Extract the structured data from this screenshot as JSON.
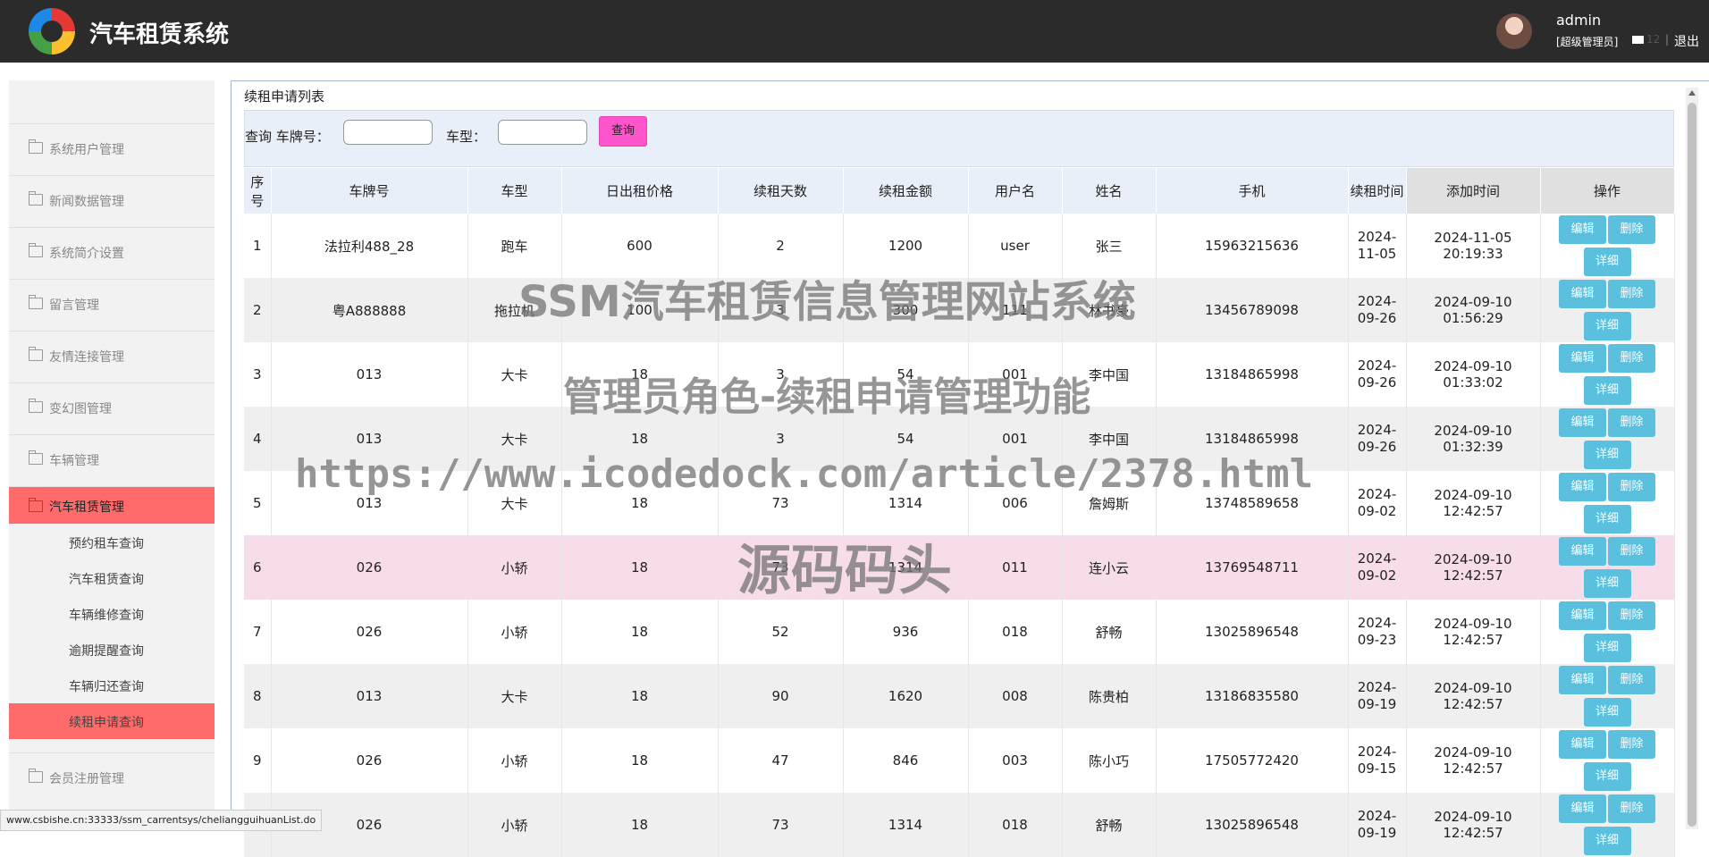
{
  "header": {
    "app_title": "汽车租赁系统",
    "user_name": "admin",
    "user_role": "[超级管理员]",
    "mail_count": "12",
    "separator": "|",
    "logout": "退出"
  },
  "sidebar": {
    "items": [
      {
        "label": "系统用户管理"
      },
      {
        "label": "新闻数据管理"
      },
      {
        "label": "系统简介设置"
      },
      {
        "label": "留言管理"
      },
      {
        "label": "友情连接管理"
      },
      {
        "label": "变幻图管理"
      },
      {
        "label": "车辆管理"
      },
      {
        "label": "汽车租赁管理"
      },
      {
        "label": "会员注册管理"
      }
    ],
    "sub_items": [
      {
        "label": "预约租车查询"
      },
      {
        "label": "汽车租赁查询"
      },
      {
        "label": "车辆维修查询"
      },
      {
        "label": "逾期提醒查询"
      },
      {
        "label": "车辆归还查询"
      },
      {
        "label": "续租申请查询"
      }
    ]
  },
  "main": {
    "panel_title": "续租申请列表",
    "search": {
      "query_label": "查询 车牌号：",
      "plate_value": "",
      "type_label": "车型：",
      "type_value": "",
      "button": "查询"
    },
    "table": {
      "headers": [
        "序号",
        "车牌号",
        "车型",
        "日出租价格",
        "续租天数",
        "续租金额",
        "用户名",
        "姓名",
        "手机",
        "续租时间",
        "添加时间",
        "操作"
      ],
      "rows": [
        {
          "no": "1",
          "plate": "法拉利488_28",
          "type": "跑车",
          "price": "600",
          "days": "2",
          "amount": "1200",
          "username": "user",
          "name": "张三",
          "phone": "15963215636",
          "renew_date": "2024-11-05",
          "added": "2024-11-05 20:19:33"
        },
        {
          "no": "2",
          "plate": "粤A888888",
          "type": "拖拉机",
          "price": "100",
          "days": "3",
          "amount": "300",
          "username": "111",
          "name": "林书豪",
          "phone": "13456789098",
          "renew_date": "2024-09-26",
          "added": "2024-09-10 01:56:29"
        },
        {
          "no": "3",
          "plate": "013",
          "type": "大卡",
          "price": "18",
          "days": "3",
          "amount": "54",
          "username": "001",
          "name": "李中国",
          "phone": "13184865998",
          "renew_date": "2024-09-26",
          "added": "2024-09-10 01:33:02"
        },
        {
          "no": "4",
          "plate": "013",
          "type": "大卡",
          "price": "18",
          "days": "3",
          "amount": "54",
          "username": "001",
          "name": "李中国",
          "phone": "13184865998",
          "renew_date": "2024-09-26",
          "added": "2024-09-10 01:32:39"
        },
        {
          "no": "5",
          "plate": "013",
          "type": "大卡",
          "price": "18",
          "days": "73",
          "amount": "1314",
          "username": "006",
          "name": "詹姆斯",
          "phone": "13748589658",
          "renew_date": "2024-09-02",
          "added": "2024-09-10 12:42:57"
        },
        {
          "no": "6",
          "plate": "026",
          "type": "小轿",
          "price": "18",
          "days": "73",
          "amount": "1314",
          "username": "011",
          "name": "连小云",
          "phone": "13769548711",
          "renew_date": "2024-09-02",
          "added": "2024-09-10 12:42:57"
        },
        {
          "no": "7",
          "plate": "026",
          "type": "小轿",
          "price": "18",
          "days": "52",
          "amount": "936",
          "username": "018",
          "name": "舒畅",
          "phone": "13025896548",
          "renew_date": "2024-09-23",
          "added": "2024-09-10 12:42:57"
        },
        {
          "no": "8",
          "plate": "013",
          "type": "大卡",
          "price": "18",
          "days": "90",
          "amount": "1620",
          "username": "008",
          "name": "陈贵柏",
          "phone": "13186835580",
          "renew_date": "2024-09-19",
          "added": "2024-09-10 12:42:57"
        },
        {
          "no": "9",
          "plate": "026",
          "type": "小轿",
          "price": "18",
          "days": "47",
          "amount": "846",
          "username": "003",
          "name": "陈小巧",
          "phone": "17505772420",
          "renew_date": "2024-09-15",
          "added": "2024-09-10 12:42:57"
        },
        {
          "no": "10",
          "plate": "026",
          "type": "小轿",
          "price": "18",
          "days": "73",
          "amount": "1314",
          "username": "018",
          "name": "舒畅",
          "phone": "13025896548",
          "renew_date": "2024-09-19",
          "added": "2024-09-10 12:42:57"
        }
      ],
      "actions": {
        "edit": "编辑",
        "delete": "删除",
        "detail": "详细"
      }
    }
  },
  "watermark": {
    "line1": "SSM汽车租赁信息管理网站系统",
    "line2": "管理员角色-续租申请管理功能",
    "line3": "https://www.icodedock.com/article/2378.html",
    "line4": "源码码头"
  },
  "status_url": "www.csbishe.cn:33333/ssm_carrentsys/cheliangguihuanList.do"
}
